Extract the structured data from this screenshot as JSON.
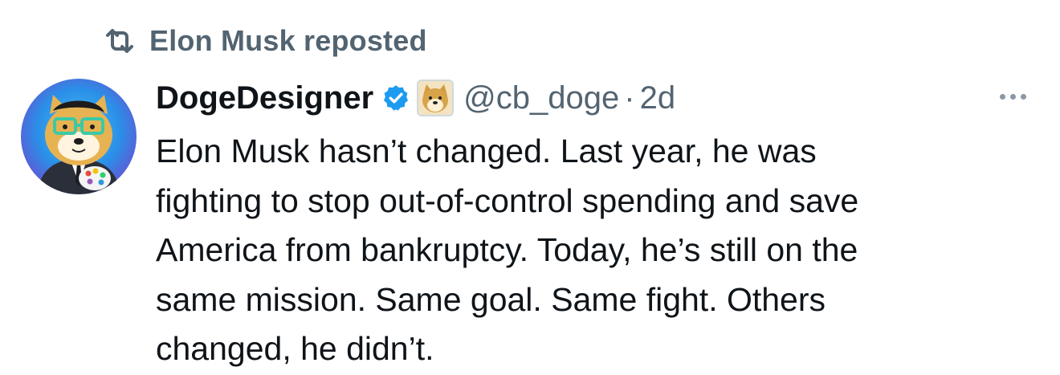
{
  "repost": {
    "icon": "repost-icon",
    "label": "Elon Musk reposted"
  },
  "tweet": {
    "avatar": "doge-designer-avatar",
    "display_name": "DogeDesigner",
    "verified_icon": "verified-badge-icon",
    "affiliation_icon": "doge-affiliate-badge-icon",
    "handle": "@cb_doge",
    "separator": "·",
    "timestamp": "2d",
    "more_icon": "more-options-icon",
    "text_lines": [
      "Elon Musk hasn’t changed. Last year, he was",
      "fighting to stop out-of-control spending and save",
      "America from bankruptcy. Today, he’s still on the",
      "same mission. Same goal. Same fight. Others",
      "changed, he didn’t."
    ]
  },
  "colors": {
    "text_primary": "#0f1419",
    "text_secondary": "#536471",
    "verified_blue": "#1d9bf0"
  }
}
